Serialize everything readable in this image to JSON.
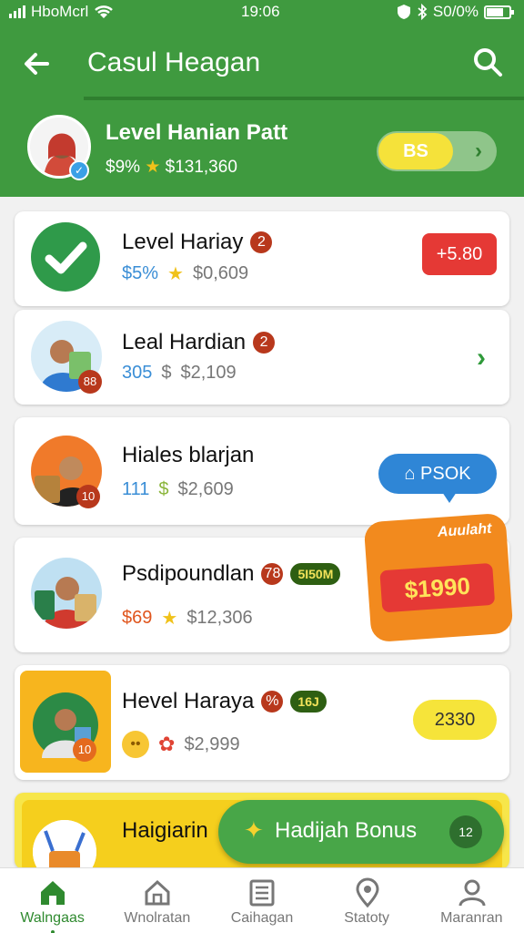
{
  "status_bar": {
    "carrier": "HboMcrl",
    "time": "19:06",
    "battery": "S0/0%"
  },
  "header": {
    "title": "Casul Heagan",
    "back_icon": "arrow-left-icon",
    "search_icon": "search-icon"
  },
  "hero": {
    "name": "Level Hanian Patt",
    "percent": "$9%",
    "star": "★",
    "amount": "$131,360",
    "toggle_label": "BS",
    "toggle_chevron": "›"
  },
  "items": [
    {
      "name": "Level Hariay",
      "count": "2",
      "stat1": "$5%",
      "sep": "★",
      "stat2": "$0,609",
      "action": "+5.80"
    },
    {
      "name": "Leal Hardian",
      "count": "2",
      "stat1": "305",
      "sep": "$",
      "stat2": "$2,109",
      "thumb_badge": "88",
      "chevron": "›"
    },
    {
      "name": "Hiales blarjan",
      "stat1": "111",
      "sep": "$",
      "stat2": "$2,609",
      "thumb_badge": "10",
      "action": "PSOK"
    },
    {
      "name": "Psdipoundlan",
      "count": "78",
      "tag": "5I50M",
      "stat1": "$69",
      "sep": "★",
      "stat2": "$12,306",
      "promo_label": "Auulaht",
      "promo_price": "$1990"
    },
    {
      "name": "Hevel Haraya",
      "count": "%",
      "tag": "16J",
      "face": "••",
      "flower": "✿",
      "stat2": "$2,999",
      "thumb_badge": "10",
      "action": "2330"
    },
    {
      "name": "Haigiarin"
    }
  ],
  "floating_button": {
    "label": "Hadijah Bonus",
    "badge": "12"
  },
  "nav": [
    {
      "label": "Walngaas",
      "icon": "home-icon",
      "active": true
    },
    {
      "label": "Wnolratan",
      "icon": "store-icon",
      "active": false
    },
    {
      "label": "Caihagan",
      "icon": "list-icon",
      "active": false
    },
    {
      "label": "Statoty",
      "icon": "location-icon",
      "active": false
    },
    {
      "label": "Maranran",
      "icon": "profile-icon",
      "active": false
    }
  ],
  "colors": {
    "brand_green": "#3f9a3f",
    "accent_red": "#e53935",
    "accent_blue": "#2f86d6",
    "accent_yellow": "#f6e43a",
    "promo_orange": "#f28a1e"
  }
}
